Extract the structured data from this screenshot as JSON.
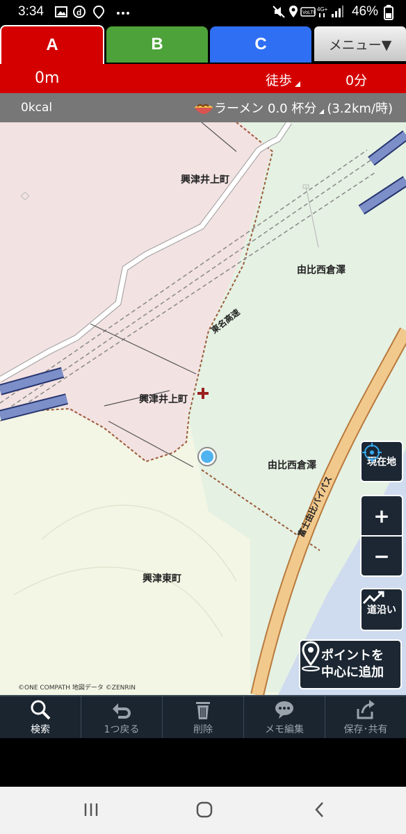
{
  "status": {
    "time": "3:34",
    "battery": "46%"
  },
  "tabs": [
    {
      "label": "A",
      "color": "#d40000",
      "active": true
    },
    {
      "label": "B",
      "color": "#4ea23a",
      "active": false
    },
    {
      "label": "C",
      "color": "#2f6ff3",
      "active": false
    }
  ],
  "menu": {
    "label": "メニュー▼"
  },
  "info": {
    "distance": "0m",
    "mode": "徒歩",
    "duration": "0分"
  },
  "calories": {
    "kcal": "0kcal",
    "ramen": "ラーメン 0.0 杯分",
    "speed": "(3.2km/時)"
  },
  "map": {
    "places": [
      {
        "name": "興津井上町"
      },
      {
        "name": "由比西倉澤"
      },
      {
        "name": "興津井上町"
      },
      {
        "name": "由比西倉澤"
      },
      {
        "name": "興津東町"
      }
    ],
    "roads": {
      "tomei": "東名高速",
      "bypass": "富士由比バイパス"
    },
    "copyright": "©ONE COMPATH 地図データ ©ZENRIN"
  },
  "map_buttons": {
    "current_location": "現在地",
    "zoom_in": "+",
    "zoom_out": "−",
    "along_road": "道沿い",
    "add_point_line1": "ポイントを",
    "add_point_line2": "中心に追加"
  },
  "toolbar": {
    "search": "検索",
    "undo": "1つ戻る",
    "delete": "削除",
    "memo": "メモ編集",
    "save": "保存･共有"
  }
}
